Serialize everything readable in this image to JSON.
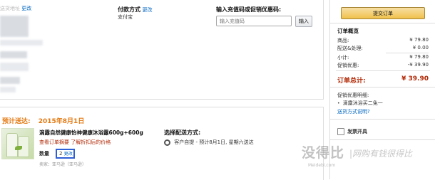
{
  "address": {
    "partial_label": "送货地址",
    "change": "更改"
  },
  "payment": {
    "label": "付款方式",
    "change": "更改",
    "value": "支付宝"
  },
  "promo": {
    "label": "输入充值码或促销优惠码:",
    "placeholder": "输入充值码",
    "apply": "输入"
  },
  "delivery": {
    "label": "预计送达:",
    "date": "2015年8月1日"
  },
  "item": {
    "title": "滴露自然健康怡神健康沐浴露600g+600g",
    "red_link": "查看订单摘要",
    "discount_link": "了解折扣后的价格",
    "qty_label": "数量",
    "qty_value": "2",
    "qty_change": "更改",
    "seller": "卖家：亚马逊（亚马逊）"
  },
  "shipping": {
    "label": "选择配送方式:",
    "option": "客户自提 -  预计8月1日, 星期六送达"
  },
  "sidebar": {
    "submit": "提交订单",
    "summary_title": "订单概览",
    "rows": [
      {
        "label": "商品:",
        "value": "¥ 79.80"
      },
      {
        "label": "配送&处理:",
        "value": "¥ 0.00"
      },
      {
        "label": "小计:",
        "value": "¥ 79.80"
      },
      {
        "label": "促销优惠:",
        "value": "-¥ 39.90"
      }
    ],
    "total_label": "订单总计:",
    "total_value": "¥ 39.90",
    "promo_title": "促销优惠明细:",
    "promo_item": "滴露沐浴买二免一",
    "free_ship_link": "送货方式说明?",
    "invoice": "发票开具"
  },
  "watermark": {
    "main": "没得比",
    "sub": "|网购有钱很得比",
    "url": "Meidebi.com"
  },
  "colors": {
    "accent_orange": "#e47911",
    "price_red": "#b12704",
    "link_blue": "#0066c0",
    "submit_gold": "#f0c14b"
  }
}
